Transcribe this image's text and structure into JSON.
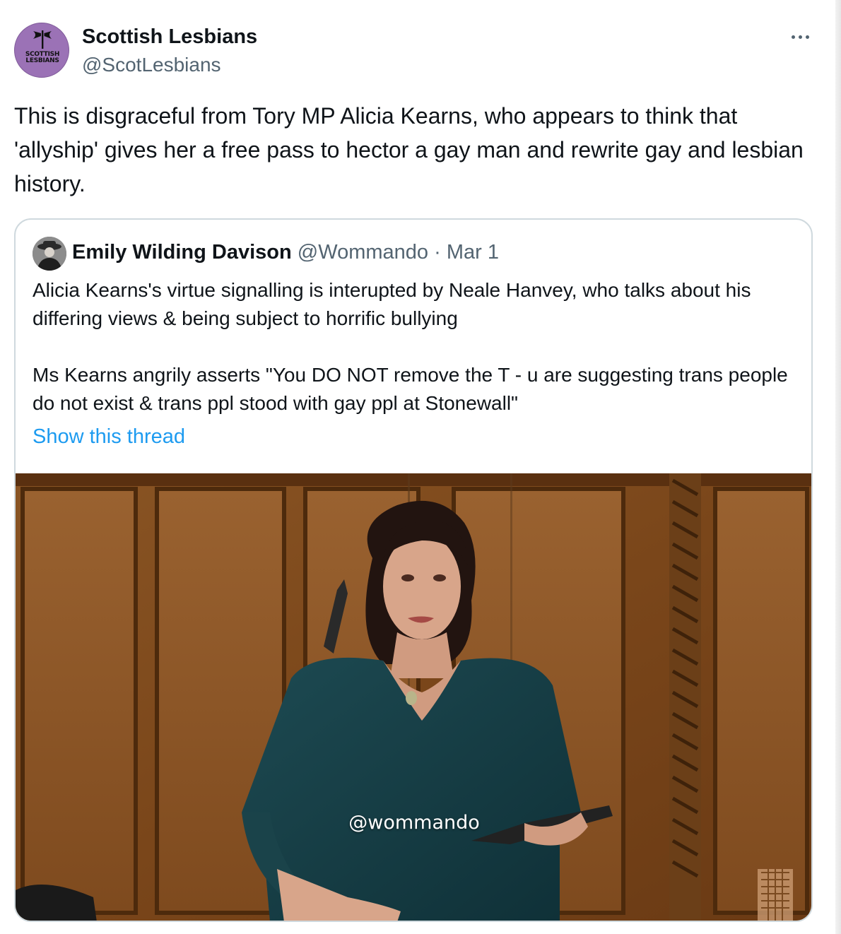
{
  "tweet": {
    "author_name": "Scottish Lesbians",
    "author_handle": "@ScotLesbians",
    "avatar_line1": "SCOTTISH",
    "avatar_line2": "LESBIANS",
    "text": "This is disgraceful from Tory MP Alicia Kearns, who appears to think that 'allyship' gives her a free pass to hector a gay man and rewrite gay and lesbian history.",
    "more_icon": "more-horizontal-icon"
  },
  "quote": {
    "author_name": "Emily Wilding Davison",
    "author_handle": "@Wommando",
    "separator": "·",
    "date": "Mar 1",
    "text": "Alicia Kearns's virtue signalling is interupted by Neale Hanvey, who talks about his differing views & being subject to horrific bullying\n\nMs Kearns angrily asserts \"You DO NOT remove the T - u are suggesting trans people do not exist & trans ppl stood with gay ppl at Stonewall\"",
    "show_thread_label": "Show this thread",
    "video_watermark": "@wommando"
  },
  "colors": {
    "text_primary": "#0f1419",
    "text_secondary": "#536471",
    "link": "#1d9bf0",
    "border": "#cfd9de",
    "avatar_purple": "#9b72b6"
  }
}
